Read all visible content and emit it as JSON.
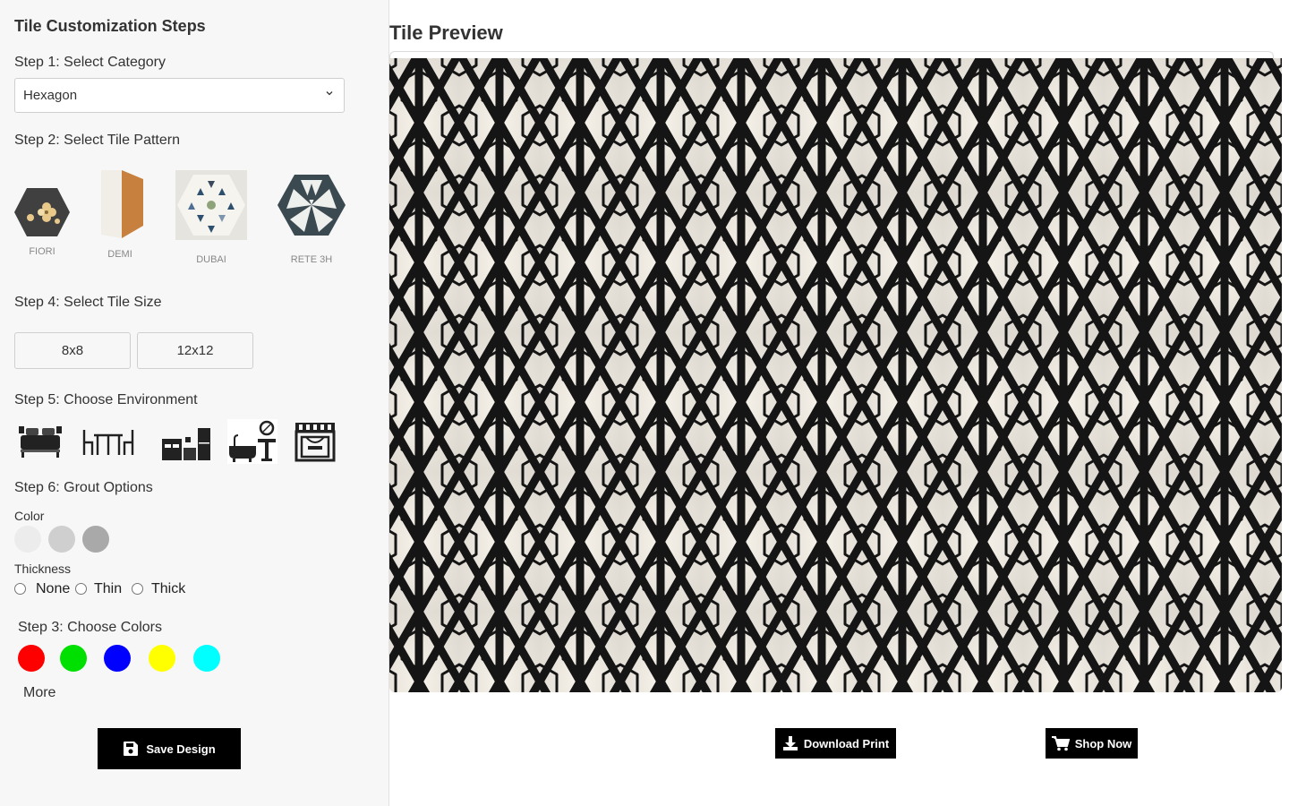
{
  "sidebar": {
    "title": "Tile Customization Steps",
    "step1": {
      "label": "Step 1: Select Category",
      "selected": "Hexagon"
    },
    "step2": {
      "label": "Step 2: Select Tile Pattern",
      "patterns": [
        {
          "name": "FIORI"
        },
        {
          "name": "DEMI"
        },
        {
          "name": "DUBAI"
        },
        {
          "name": "RETE 3H"
        }
      ]
    },
    "step4": {
      "label": "Step 4: Select Tile Size",
      "sizes": [
        "8x8",
        "12x12"
      ]
    },
    "step5": {
      "label": "Step 5: Choose Environment",
      "environments": [
        "bedroom-icon",
        "dining-icon",
        "kitchen-icon",
        "bathroom-icon",
        "storefront-icon"
      ]
    },
    "step6": {
      "label": "Step 6: Grout Options",
      "color_label": "Color",
      "grout_colors": [
        "#ececec",
        "#cfcfcf",
        "#a9a9a9"
      ],
      "thickness_label": "Thickness",
      "thickness_options": [
        "None",
        "Thin",
        "Thick"
      ]
    },
    "step3": {
      "label": "Step 3: Choose Colors",
      "colors": [
        "#ff0000",
        "#00e000",
        "#0000ff",
        "#ffff00",
        "#00ffff"
      ],
      "more_label": "More"
    },
    "save_label": "Save Design"
  },
  "preview": {
    "title": "Tile Preview",
    "download_label": "Download Print",
    "shop_label": "Shop Now"
  }
}
